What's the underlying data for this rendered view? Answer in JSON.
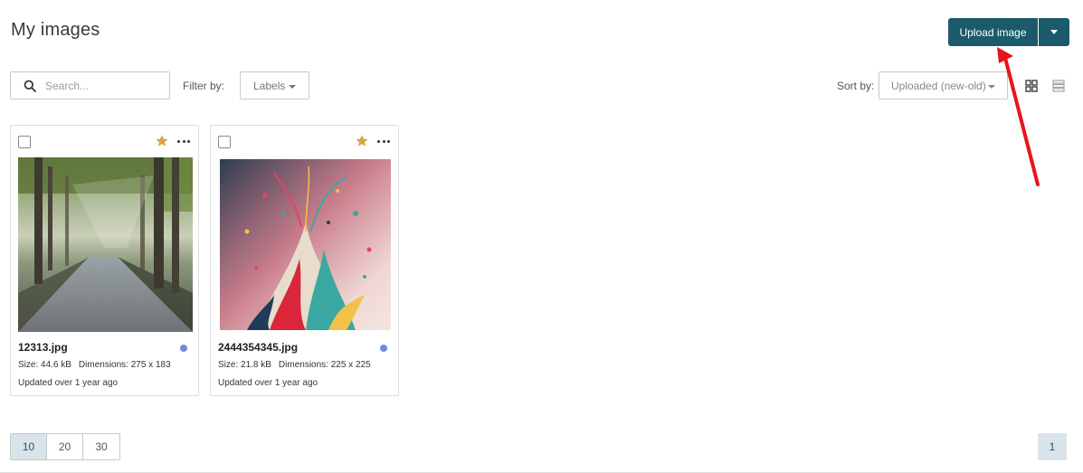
{
  "page": {
    "title": "My images"
  },
  "toolbar": {
    "upload_label": "Upload image"
  },
  "filters": {
    "search_placeholder": "Search...",
    "filter_label": "Filter by:",
    "labels_value": "Labels",
    "sort_label": "Sort by:",
    "sort_value": "Uploaded (new-old)"
  },
  "cards": [
    {
      "filename": "12313.jpg",
      "size": "Size: 44.6 kB",
      "dimensions": "Dimensions: 275 x 183",
      "updated": "Updated over 1 year ago",
      "starred": true
    },
    {
      "filename": "2444354345.jpg",
      "size": "Size: 21.8 kB",
      "dimensions": "Dimensions: 225 x 225",
      "updated": "Updated over 1 year ago",
      "starred": true
    }
  ],
  "pagination": {
    "page_sizes": [
      "10",
      "20",
      "30"
    ],
    "selected_page_size": "10",
    "current_page": "1"
  },
  "colors": {
    "accent": "#1b5a6a",
    "star": "#d9a441",
    "label_dot": "#6f88e8",
    "annotation_arrow": "#e8141b"
  }
}
